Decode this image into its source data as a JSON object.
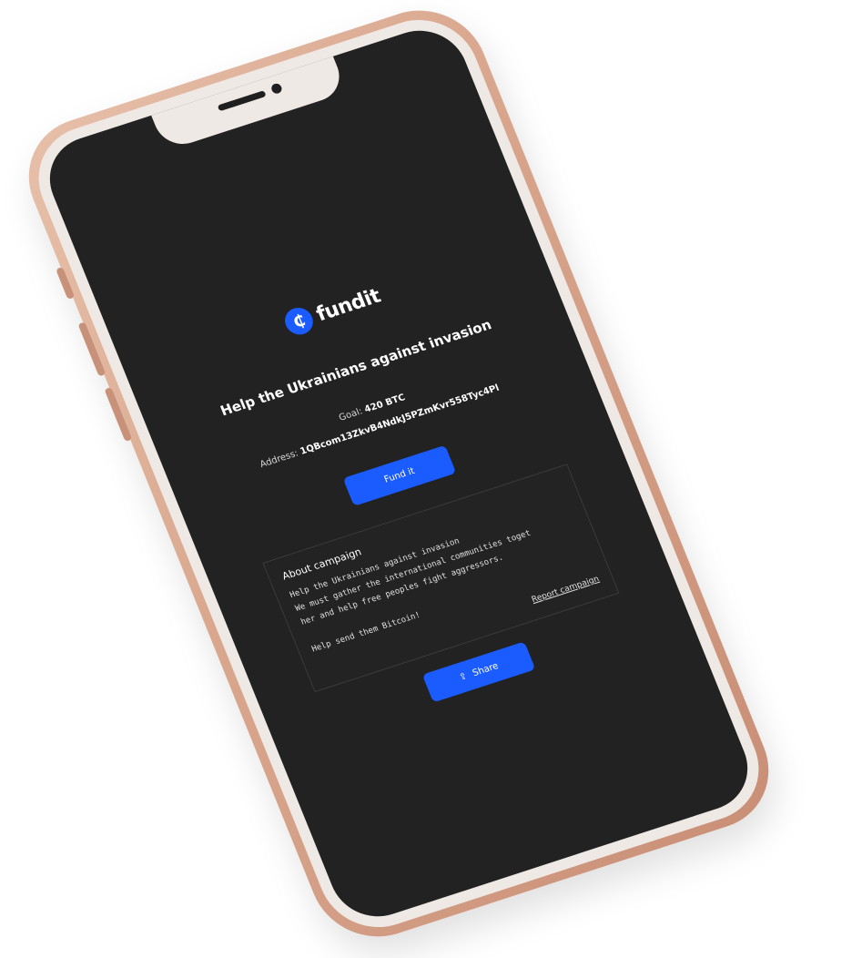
{
  "brand": {
    "name": "fundit",
    "icon": "bitcoin-c-logo-icon",
    "accent_color": "#1a5cff",
    "screen_color": "#222222",
    "device_color": "#d9a78e"
  },
  "campaign": {
    "title": "Help the Ukrainians against invasion",
    "goal_label": "Goal:",
    "goal_value": "420 BTC",
    "address_label": "Address:",
    "address_value": "1QBcom13ZkvB4NdkJ5PZmKvr558Tyc4Pl",
    "fund_button": "Fund it",
    "about_title": "About campaign",
    "about_text": "Help the Ukrainians against invasion\nWe must gather the international communities toget\nher and help free peoples fight aggressors.\n\nHelp send them Bitcoin!",
    "report_link": "Report campaign",
    "share_button": "Share",
    "share_icon": "share-icon"
  }
}
